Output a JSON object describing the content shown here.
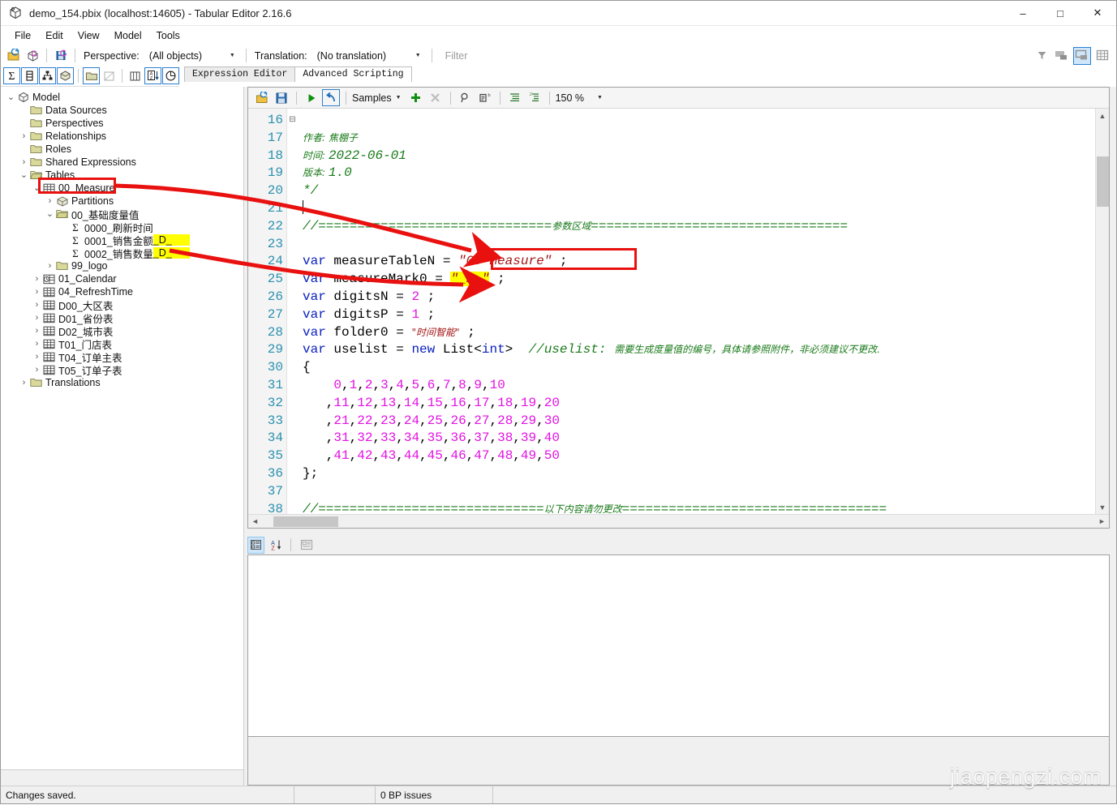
{
  "window": {
    "title": "demo_154.pbix (localhost:14605) - Tabular Editor 2.16.6",
    "app_icon": "cube-icon",
    "minimize": "–",
    "maximize": "□",
    "close": "✕"
  },
  "menu": {
    "items": [
      "File",
      "Edit",
      "View",
      "Model",
      "Tools"
    ]
  },
  "toolbar": {
    "perspective_label": "Perspective:",
    "perspective_value": "(All objects)",
    "translation_label": "Translation:",
    "translation_value": "(No translation)",
    "filter_placeholder": "Filter",
    "icons": [
      "open-model-icon",
      "refresh-model-icon",
      "save-model-icon"
    ],
    "right_icons": [
      "funnel-filter-icon",
      "hide-panel-icon",
      "show-panel-icon",
      "grid-view-icon"
    ]
  },
  "toolbar2": {
    "icons": [
      "measures-sigma-icon",
      "columns-icon",
      "hierarchies-icon",
      "partitions-icon",
      "folders-icon",
      "hidden-objects-icon",
      "columns-grid-icon",
      "sort-az-icon",
      "objects-icon"
    ]
  },
  "tree": {
    "root": "Model",
    "items": [
      {
        "label": "Model",
        "depth": 0,
        "icon": "model-cube-icon",
        "twisty": "⌄"
      },
      {
        "label": "Data Sources",
        "depth": 1,
        "icon": "folder-icon",
        "twisty": ""
      },
      {
        "label": "Perspectives",
        "depth": 1,
        "icon": "folder-icon",
        "twisty": ""
      },
      {
        "label": "Relationships",
        "depth": 1,
        "icon": "folder-icon",
        "twisty": "›"
      },
      {
        "label": "Roles",
        "depth": 1,
        "icon": "folder-icon",
        "twisty": ""
      },
      {
        "label": "Shared Expressions",
        "depth": 1,
        "icon": "folder-icon",
        "twisty": "›"
      },
      {
        "label": "Tables",
        "depth": 1,
        "icon": "folder-open-icon",
        "twisty": "⌄"
      },
      {
        "label": "00_Measure",
        "depth": 2,
        "icon": "table-icon",
        "twisty": "⌄",
        "boxed": true
      },
      {
        "label": "Partitions",
        "depth": 3,
        "icon": "partition-icon",
        "twisty": "›"
      },
      {
        "label": "00_基础度量值",
        "depth": 3,
        "icon": "folder-open-icon",
        "twisty": "⌄"
      },
      {
        "label": "0000_刷新时间",
        "depth": 4,
        "icon": "measure-sigma-icon",
        "twisty": ""
      },
      {
        "label": "0001_销售金额",
        "highlight": "_D_",
        "depth": 4,
        "icon": "measure-sigma-icon",
        "twisty": ""
      },
      {
        "label": "0002_销售数量",
        "highlight": "_D_",
        "depth": 4,
        "icon": "measure-sigma-icon",
        "twisty": ""
      },
      {
        "label": "99_logo",
        "depth": 3,
        "icon": "folder-icon",
        "twisty": "›"
      },
      {
        "label": "01_Calendar",
        "depth": 2,
        "icon": "calendar-table-icon",
        "twisty": "›"
      },
      {
        "label": "04_RefreshTime",
        "depth": 2,
        "icon": "table-icon",
        "twisty": "›"
      },
      {
        "label": "D00_大区表",
        "depth": 2,
        "icon": "table-icon",
        "twisty": "›"
      },
      {
        "label": "D01_省份表",
        "depth": 2,
        "icon": "table-icon",
        "twisty": "›"
      },
      {
        "label": "D02_城市表",
        "depth": 2,
        "icon": "table-icon",
        "twisty": "›"
      },
      {
        "label": "T01_门店表",
        "depth": 2,
        "icon": "table-icon",
        "twisty": "›"
      },
      {
        "label": "T04_订单主表",
        "depth": 2,
        "icon": "table-icon",
        "twisty": "›"
      },
      {
        "label": "T05_订单子表",
        "depth": 2,
        "icon": "table-icon",
        "twisty": "›"
      },
      {
        "label": "Translations",
        "depth": 1,
        "icon": "folder-icon",
        "twisty": "›"
      }
    ]
  },
  "tabs": [
    {
      "label": "Expression Editor",
      "active": false
    },
    {
      "label": "Advanced Scripting",
      "active": true
    }
  ],
  "editor_toolbar": {
    "open_label": "open-script-icon",
    "save_label": "save-script-icon",
    "run_label": "run-icon",
    "undo_label": "undo-icon",
    "samples_label": "Samples",
    "add_label": "add-icon",
    "delete_label": "delete-icon",
    "find_label": "find-icon",
    "replace_label": "replace-icon",
    "indent_label": "indent-icon",
    "outdent_label": "outdent-icon",
    "zoom_value": "150 %"
  },
  "code": {
    "first_line_number": 16,
    "lines": [
      {
        "n": 16,
        "segs": []
      },
      {
        "n": 17,
        "segs": [
          {
            "t": "作者: ",
            "c": "c-cmt c-cn"
          },
          {
            "t": "焦棚子",
            "c": "c-cmt c-cn"
          }
        ]
      },
      {
        "n": 18,
        "segs": [
          {
            "t": "时间: ",
            "c": "c-cmt c-cn"
          },
          {
            "t": "2022-06-01",
            "c": "c-cmt"
          }
        ]
      },
      {
        "n": 19,
        "segs": [
          {
            "t": "版本: ",
            "c": "c-cmt c-cn"
          },
          {
            "t": "1.0",
            "c": "c-cmt"
          }
        ]
      },
      {
        "n": 20,
        "segs": [
          {
            "t": "*/",
            "c": "c-cmt"
          }
        ]
      },
      {
        "n": 21,
        "segs": []
      },
      {
        "n": 22,
        "segs": [
          {
            "t": "//==============================",
            "c": "c-cmt"
          },
          {
            "t": "参数区域",
            "c": "c-cmt c-cn"
          },
          {
            "t": "=================================",
            "c": "c-cmt"
          }
        ]
      },
      {
        "n": 23,
        "segs": []
      },
      {
        "n": 24,
        "segs": [
          {
            "t": "var",
            "c": "c-kw"
          },
          {
            "t": " measureTableN = ",
            "c": ""
          },
          {
            "t": "\"00 Measure\"",
            "c": "c-str"
          },
          {
            "t": " ;",
            "c": ""
          }
        ]
      },
      {
        "n": 25,
        "segs": [
          {
            "t": "var",
            "c": "c-kw"
          },
          {
            "t": " measureMark0 = ",
            "c": ""
          },
          {
            "t": "\"_D_\"",
            "c": "c-str hl"
          },
          {
            "t": " ;",
            "c": ""
          }
        ]
      },
      {
        "n": 26,
        "segs": [
          {
            "t": "var",
            "c": "c-kw"
          },
          {
            "t": " digitsN = ",
            "c": ""
          },
          {
            "t": "2",
            "c": "c-num"
          },
          {
            "t": " ;",
            "c": ""
          }
        ]
      },
      {
        "n": 27,
        "segs": [
          {
            "t": "var",
            "c": "c-kw"
          },
          {
            "t": " digitsP = ",
            "c": ""
          },
          {
            "t": "1",
            "c": "c-num"
          },
          {
            "t": " ;",
            "c": ""
          }
        ]
      },
      {
        "n": 28,
        "segs": [
          {
            "t": "var",
            "c": "c-kw"
          },
          {
            "t": " folder0 = ",
            "c": ""
          },
          {
            "t": "\"时间智能\"",
            "c": "c-str c-cn"
          },
          {
            "t": " ;",
            "c": ""
          }
        ]
      },
      {
        "n": 29,
        "segs": [
          {
            "t": "var",
            "c": "c-kw"
          },
          {
            "t": " uselist = ",
            "c": ""
          },
          {
            "t": "new",
            "c": "c-kw"
          },
          {
            "t": " List<",
            "c": ""
          },
          {
            "t": "int",
            "c": "c-kw"
          },
          {
            "t": ">  ",
            "c": ""
          },
          {
            "t": "//uselist: ",
            "c": "c-cmt"
          },
          {
            "t": "需要生成度量值的编号，具体请参照附件，非必须建议不更改.",
            "c": "c-cmt c-cn"
          }
        ]
      },
      {
        "n": 30,
        "segs": [
          {
            "t": "{",
            "c": ""
          }
        ],
        "fold": "⊖"
      },
      {
        "n": 31,
        "segs": [
          {
            "t": "    ",
            "c": ""
          },
          {
            "t": "0",
            "c": "c-num"
          },
          {
            "t": ",",
            "c": ""
          },
          {
            "t": "1",
            "c": "c-num"
          },
          {
            "t": ",",
            "c": ""
          },
          {
            "t": "2",
            "c": "c-num"
          },
          {
            "t": ",",
            "c": ""
          },
          {
            "t": "3",
            "c": "c-num"
          },
          {
            "t": ",",
            "c": ""
          },
          {
            "t": "4",
            "c": "c-num"
          },
          {
            "t": ",",
            "c": ""
          },
          {
            "t": "5",
            "c": "c-num"
          },
          {
            "t": ",",
            "c": ""
          },
          {
            "t": "6",
            "c": "c-num"
          },
          {
            "t": ",",
            "c": ""
          },
          {
            "t": "7",
            "c": "c-num"
          },
          {
            "t": ",",
            "c": ""
          },
          {
            "t": "8",
            "c": "c-num"
          },
          {
            "t": ",",
            "c": ""
          },
          {
            "t": "9",
            "c": "c-num"
          },
          {
            "t": ",",
            "c": ""
          },
          {
            "t": "10",
            "c": "c-num"
          }
        ]
      },
      {
        "n": 32,
        "segs": [
          {
            "t": "   ,",
            "c": ""
          },
          {
            "t": "11",
            "c": "c-num"
          },
          {
            "t": ",",
            "c": ""
          },
          {
            "t": "12",
            "c": "c-num"
          },
          {
            "t": ",",
            "c": ""
          },
          {
            "t": "13",
            "c": "c-num"
          },
          {
            "t": ",",
            "c": ""
          },
          {
            "t": "14",
            "c": "c-num"
          },
          {
            "t": ",",
            "c": ""
          },
          {
            "t": "15",
            "c": "c-num"
          },
          {
            "t": ",",
            "c": ""
          },
          {
            "t": "16",
            "c": "c-num"
          },
          {
            "t": ",",
            "c": ""
          },
          {
            "t": "17",
            "c": "c-num"
          },
          {
            "t": ",",
            "c": ""
          },
          {
            "t": "18",
            "c": "c-num"
          },
          {
            "t": ",",
            "c": ""
          },
          {
            "t": "19",
            "c": "c-num"
          },
          {
            "t": ",",
            "c": ""
          },
          {
            "t": "20",
            "c": "c-num"
          }
        ]
      },
      {
        "n": 33,
        "segs": [
          {
            "t": "   ,",
            "c": ""
          },
          {
            "t": "21",
            "c": "c-num"
          },
          {
            "t": ",",
            "c": ""
          },
          {
            "t": "22",
            "c": "c-num"
          },
          {
            "t": ",",
            "c": ""
          },
          {
            "t": "23",
            "c": "c-num"
          },
          {
            "t": ",",
            "c": ""
          },
          {
            "t": "24",
            "c": "c-num"
          },
          {
            "t": ",",
            "c": ""
          },
          {
            "t": "25",
            "c": "c-num"
          },
          {
            "t": ",",
            "c": ""
          },
          {
            "t": "26",
            "c": "c-num"
          },
          {
            "t": ",",
            "c": ""
          },
          {
            "t": "27",
            "c": "c-num"
          },
          {
            "t": ",",
            "c": ""
          },
          {
            "t": "28",
            "c": "c-num"
          },
          {
            "t": ",",
            "c": ""
          },
          {
            "t": "29",
            "c": "c-num"
          },
          {
            "t": ",",
            "c": ""
          },
          {
            "t": "30",
            "c": "c-num"
          }
        ]
      },
      {
        "n": 34,
        "segs": [
          {
            "t": "   ,",
            "c": ""
          },
          {
            "t": "31",
            "c": "c-num"
          },
          {
            "t": ",",
            "c": ""
          },
          {
            "t": "32",
            "c": "c-num"
          },
          {
            "t": ",",
            "c": ""
          },
          {
            "t": "33",
            "c": "c-num"
          },
          {
            "t": ",",
            "c": ""
          },
          {
            "t": "34",
            "c": "c-num"
          },
          {
            "t": ",",
            "c": ""
          },
          {
            "t": "35",
            "c": "c-num"
          },
          {
            "t": ",",
            "c": ""
          },
          {
            "t": "36",
            "c": "c-num"
          },
          {
            "t": ",",
            "c": ""
          },
          {
            "t": "37",
            "c": "c-num"
          },
          {
            "t": ",",
            "c": ""
          },
          {
            "t": "38",
            "c": "c-num"
          },
          {
            "t": ",",
            "c": ""
          },
          {
            "t": "39",
            "c": "c-num"
          },
          {
            "t": ",",
            "c": ""
          },
          {
            "t": "40",
            "c": "c-num"
          }
        ]
      },
      {
        "n": 35,
        "segs": [
          {
            "t": "   ,",
            "c": ""
          },
          {
            "t": "41",
            "c": "c-num"
          },
          {
            "t": ",",
            "c": ""
          },
          {
            "t": "42",
            "c": "c-num"
          },
          {
            "t": ",",
            "c": ""
          },
          {
            "t": "43",
            "c": "c-num"
          },
          {
            "t": ",",
            "c": ""
          },
          {
            "t": "44",
            "c": "c-num"
          },
          {
            "t": ",",
            "c": ""
          },
          {
            "t": "45",
            "c": "c-num"
          },
          {
            "t": ",",
            "c": ""
          },
          {
            "t": "46",
            "c": "c-num"
          },
          {
            "t": ",",
            "c": ""
          },
          {
            "t": "47",
            "c": "c-num"
          },
          {
            "t": ",",
            "c": ""
          },
          {
            "t": "48",
            "c": "c-num"
          },
          {
            "t": ",",
            "c": ""
          },
          {
            "t": "49",
            "c": "c-num"
          },
          {
            "t": ",",
            "c": ""
          },
          {
            "t": "50",
            "c": "c-num"
          }
        ]
      },
      {
        "n": 36,
        "segs": [
          {
            "t": "};",
            "c": ""
          }
        ]
      },
      {
        "n": 37,
        "segs": []
      },
      {
        "n": 38,
        "segs": [
          {
            "t": "//=============================",
            "c": "c-cmt"
          },
          {
            "t": "以下内容请勿更改",
            "c": "c-cmt c-cn"
          },
          {
            "t": "==================================",
            "c": "c-cmt"
          }
        ]
      }
    ]
  },
  "annotations": {
    "callout_table": "00 Measure",
    "callout_mark": "_D_",
    "boxed_code_line": 24,
    "highlight_code_line": 25,
    "arrow_color": "#e8110f",
    "highlight_color": "#ffff00"
  },
  "lower_toolbar": {
    "icons": [
      "categorized-icon",
      "sort-az-icon",
      "property-pages-icon"
    ]
  },
  "statusbar": {
    "message": "Changes saved.",
    "cell2": "",
    "bp_issues": "0 BP issues",
    "cell4": ""
  },
  "watermark": {
    "text": "jiaopengzi.com"
  }
}
